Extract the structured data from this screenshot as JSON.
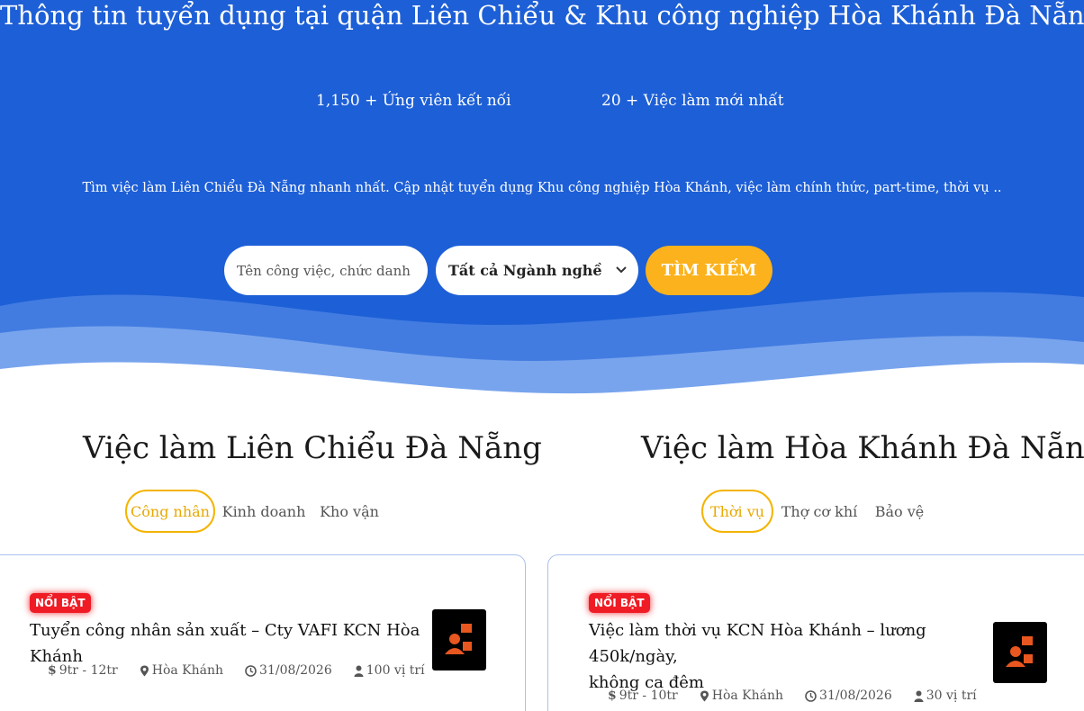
{
  "hero": {
    "title": "Thông tin tuyển dụng tại quận Liên Chiểu & Khu công nghiệp Hòa Khánh Đà Nẵng",
    "stat_candidates": "1,150 + Ứng viên kết nối",
    "stat_jobs": "20 + Việc làm mới nhất",
    "tagline": "Tìm việc làm Liên Chiểu Đà Nẵng nhanh nhất. Cập nhật tuyển dụng Khu công nghiệp Hòa Khánh, việc làm chính thức, part-time, thời vụ ..",
    "search_placeholder": "Tên công việc, chức danh ...",
    "select_value": "Tất cả Ngành nghề",
    "search_button": "TÌM KIẾM"
  },
  "colors": {
    "hero_bg": "#1d5fd6",
    "accent": "#fbb21c",
    "badge": "#ef1c25",
    "card_border": "#a9c1ee"
  },
  "left_section": {
    "title": "Việc làm Liên Chiểu Đà Nẵng",
    "tabs": [
      "Công nhân",
      "Kinh doanh",
      "Kho vận"
    ],
    "active_tab": "Công nhân",
    "job": {
      "badge": "NỔI BẬT",
      "title": "Tuyển công nhân sản xuất – Cty VAFI KCN Hòa Khánh",
      "salary": "9tr - 12tr",
      "location": "Hòa Khánh",
      "deadline": "31/08/2026",
      "positions": "100 vị trí"
    }
  },
  "right_section": {
    "title": "Việc làm Hòa Khánh Đà Nẵng",
    "tabs": [
      "Thời vụ",
      "Thợ cơ khí",
      "Bảo vệ"
    ],
    "active_tab": "Thời vụ",
    "job": {
      "badge": "NỔI BẬT",
      "title_line1": "Việc làm thời vụ KCN Hòa Khánh – lương 450k/ngày,",
      "title_line2": "không ca đêm",
      "salary": "9tr - 10tr",
      "location": "Hòa Khánh",
      "deadline": "31/08/2026",
      "positions": "30 vị trí"
    }
  },
  "icons": [
    "dollar-icon",
    "map-pin-icon",
    "clock-icon",
    "user-icon",
    "chevron-down-icon",
    "company-logo-icon"
  ]
}
